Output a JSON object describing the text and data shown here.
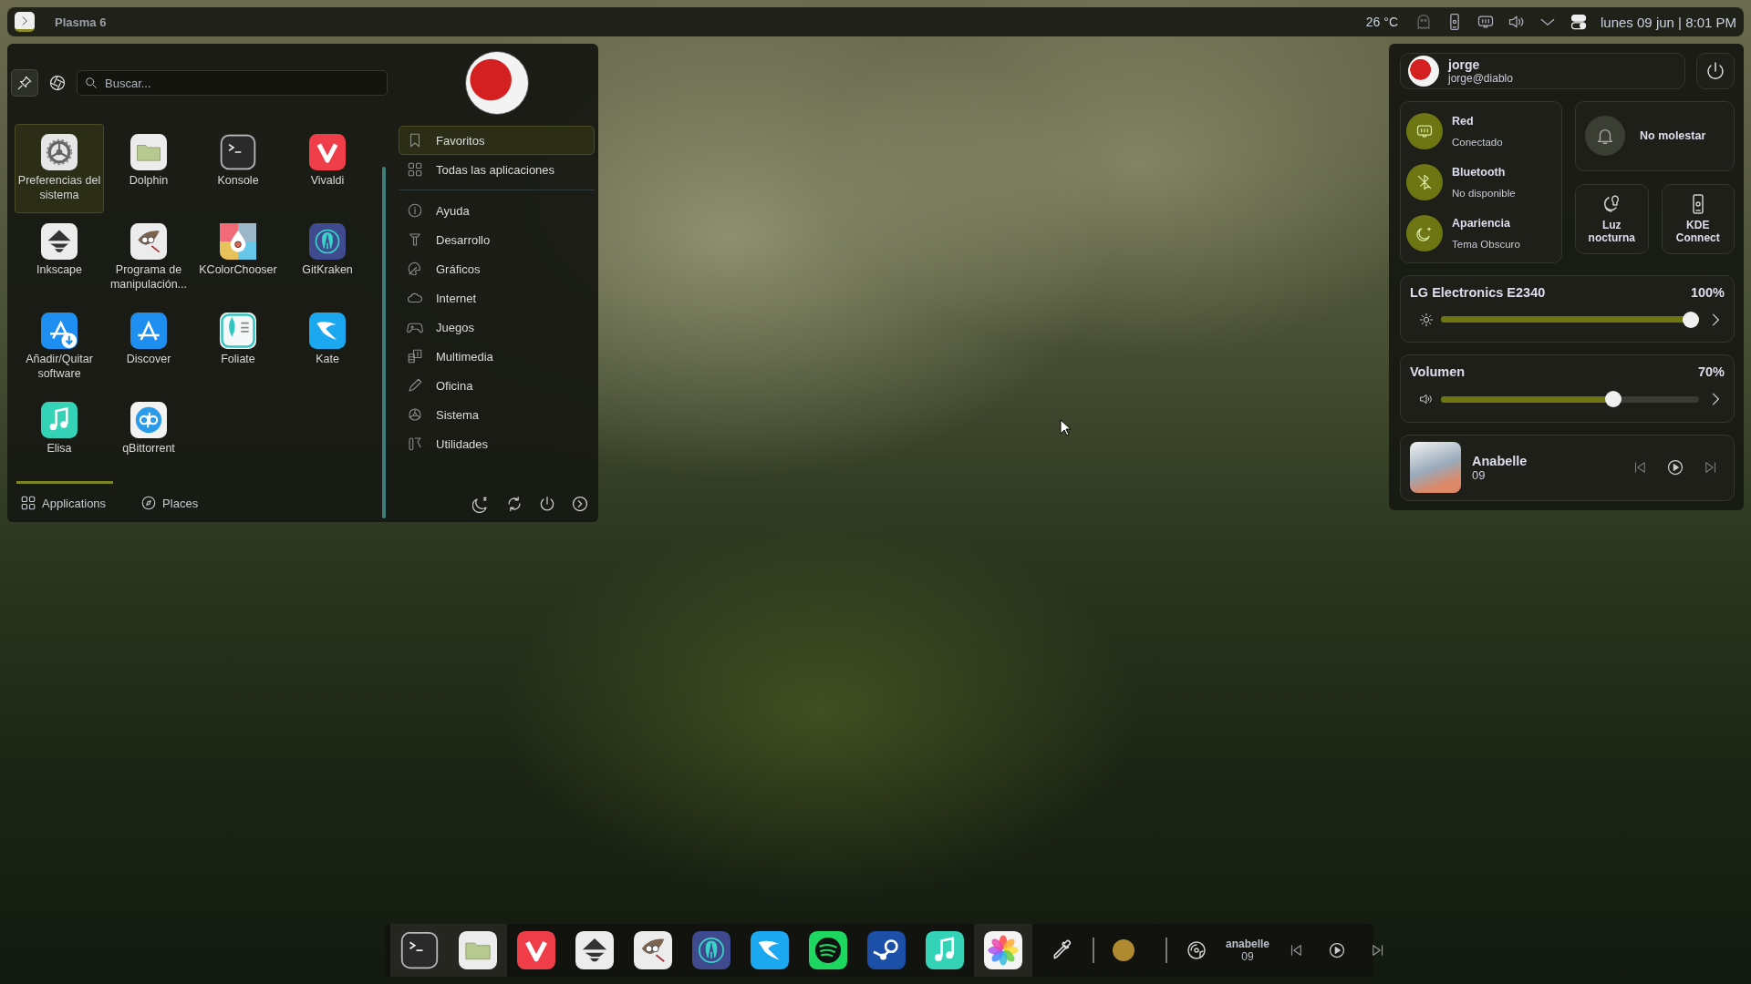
{
  "top_bar": {
    "launcher_label": "Plasma 6",
    "temperature": "26 °C",
    "clock": "lunes 09 jun | 8:01 PM"
  },
  "launcher": {
    "search": {
      "placeholder": "Buscar..."
    },
    "apps": [
      {
        "name": "Preferencias del sistema",
        "kind": "settings",
        "selected": true
      },
      {
        "name": "Dolphin",
        "kind": "files",
        "selected": false
      },
      {
        "name": "Konsole",
        "kind": "terminal",
        "selected": false
      },
      {
        "name": "Vivaldi",
        "kind": "vivaldi",
        "selected": false
      },
      {
        "name": "Inkscape",
        "kind": "inkscape",
        "selected": false
      },
      {
        "name": "Programa de manipulación...",
        "kind": "gimp",
        "selected": false
      },
      {
        "name": "KColorChooser",
        "kind": "colorchooser",
        "selected": false
      },
      {
        "name": "GitKraken",
        "kind": "gitkraken",
        "selected": false
      },
      {
        "name": "Añadir/Quitar software",
        "kind": "storeadd",
        "selected": false
      },
      {
        "name": "Discover",
        "kind": "store",
        "selected": false
      },
      {
        "name": "Foliate",
        "kind": "foliate",
        "selected": false
      },
      {
        "name": "Kate",
        "kind": "kate",
        "selected": false
      },
      {
        "name": "Elisa",
        "kind": "music",
        "selected": false
      },
      {
        "name": "qBittorrent",
        "kind": "qbittorrent",
        "selected": false
      }
    ],
    "categories": [
      {
        "label": "Favoritos",
        "kind": "bookmark",
        "selected": true
      },
      {
        "label": "Todas las aplicaciones",
        "kind": "grid",
        "selected": false
      },
      {
        "label": "Ayuda",
        "kind": "info",
        "selected": false
      },
      {
        "label": "Desarrollo",
        "kind": "hammer",
        "selected": false
      },
      {
        "label": "Gráficos",
        "kind": "palette",
        "selected": false
      },
      {
        "label": "Internet",
        "kind": "cloud",
        "selected": false
      },
      {
        "label": "Juegos",
        "kind": "gamepad",
        "selected": false
      },
      {
        "label": "Multimedia",
        "kind": "film",
        "selected": false
      },
      {
        "label": "Oficina",
        "kind": "pencil",
        "selected": false
      },
      {
        "label": "Sistema",
        "kind": "gear",
        "selected": false
      },
      {
        "label": "Utilidades",
        "kind": "tools",
        "selected": false
      }
    ],
    "bottom_tabs": [
      {
        "label": "Applications",
        "kind": "grid",
        "selected": true
      },
      {
        "label": "Places",
        "kind": "compass",
        "selected": false
      }
    ]
  },
  "quick_settings": {
    "user": {
      "name": "jorge",
      "host": "jorge@diablo"
    },
    "toggles": [
      {
        "title": "Red",
        "status": "Conectado",
        "kind": "network",
        "on": true
      },
      {
        "title": "Bluetooth",
        "status": "No disponible",
        "kind": "bluetooth",
        "on": true
      },
      {
        "title": "Apariencia",
        "status": "Tema Obscuro",
        "kind": "moon",
        "on": true
      }
    ],
    "dnd": {
      "label": "No molestar",
      "on": false
    },
    "tiles": [
      {
        "label": "Luz nocturna",
        "kind": "nightlight"
      },
      {
        "label": "KDE Connect",
        "kind": "phone"
      }
    ],
    "sliders": [
      {
        "title": "LG Electronics E2340",
        "reading": "100%",
        "kind": "brightness",
        "level": 1.0
      },
      {
        "title": "Volumen",
        "reading": "70%",
        "kind": "volume",
        "level": 0.7
      }
    ],
    "media": {
      "title": "Anabelle",
      "subtitle": "09"
    }
  },
  "dock": {
    "apps": [
      {
        "kind": "terminal",
        "active": true
      },
      {
        "kind": "files",
        "active": true
      },
      {
        "kind": "vivaldi",
        "active": false
      },
      {
        "kind": "inkscape",
        "active": false
      },
      {
        "kind": "gimp",
        "active": false
      },
      {
        "kind": "gitkraken",
        "active": false
      },
      {
        "kind": "kate",
        "active": false
      },
      {
        "kind": "spotify",
        "active": false
      },
      {
        "kind": "steam",
        "active": false
      },
      {
        "kind": "music",
        "active": false
      },
      {
        "kind": "photos",
        "active": true
      }
    ],
    "color_swatch": {
      "color": "#b08a30"
    },
    "media": {
      "title": "anabelle",
      "subtitle": "09"
    }
  }
}
